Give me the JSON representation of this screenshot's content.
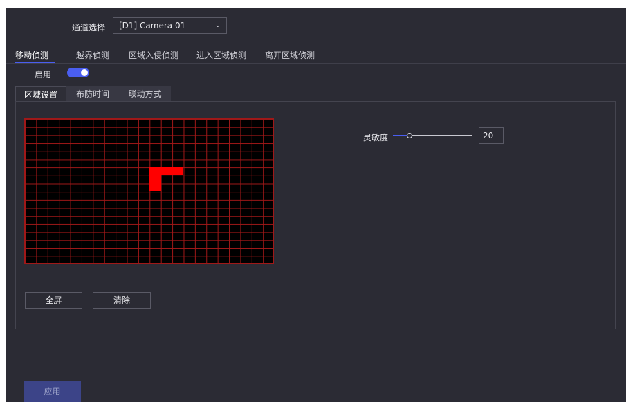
{
  "channel": {
    "label": "通道选择",
    "selected": "[D1] Camera 01"
  },
  "tabs": [
    "移动侦测",
    "越界侦测",
    "区域入侵侦测",
    "进入区域侦测",
    "离开区域侦测"
  ],
  "enable": {
    "label": "启用",
    "on": true
  },
  "subtabs": [
    "区域设置",
    "布防时间",
    "联动方式"
  ],
  "grid": {
    "line_color": "#a01818",
    "active_color": "#ff0000"
  },
  "buttons": {
    "fullscreen": "全屏",
    "clear": "清除"
  },
  "sensitivity": {
    "label": "灵敏度",
    "value": "20",
    "fraction": 0.2
  },
  "apply": "应用",
  "colors": {
    "accent": "#4a5ef0",
    "panel_bg": "#2b2b34"
  }
}
